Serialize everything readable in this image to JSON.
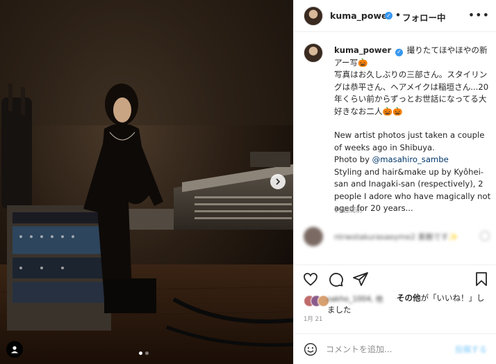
{
  "post": {
    "username": "kuma_power",
    "follow_status": "フォロー中",
    "more_label": "•••",
    "caption": {
      "jp_line1": "撮りたてほやほやの新アー写🎃",
      "jp_line2": "写真はお久しぶりの三部さん。スタイリングは恭平さん、ヘアメイクは稲垣さん...20年くらい前からずっとお世話になってる大好きなお二人🎃🎃",
      "en_part1": "New artist photos just taken a couple of weeks ago in Shibuya.",
      "en_photo_prefix": "Photo by ",
      "en_mention": "@masahiro_sambe",
      "en_part2": "Styling and hair&make up by Kyôhei-san and Inagaki-san (respectively), 2 people I adore who have magically not aged for 20 years..."
    },
    "time_ago": "19週間前",
    "blurred_comment": "ntrwotakurasaeyme2 素敵です✨",
    "likes": {
      "blurred_names": "sakho_1004, 他",
      "others_bold": "その他",
      "suffix_line1": "が「いいね！」し",
      "suffix_line2": "ました"
    },
    "date": "1月 21",
    "comment_placeholder": "コメントを追加...",
    "post_button": "投稿する"
  },
  "carousel": {
    "current": 1,
    "total": 2
  },
  "icons": {
    "verified": "verified-badge-icon",
    "heart": "heart-icon",
    "comment": "comment-icon",
    "share": "share-icon",
    "save": "bookmark-icon",
    "emoji": "emoji-icon",
    "next": "chevron-right-icon",
    "tag": "user-tag-icon"
  },
  "colors": {
    "verified_blue": "#3897f0",
    "mention": "#00376b",
    "muted": "#8e8e8e"
  }
}
